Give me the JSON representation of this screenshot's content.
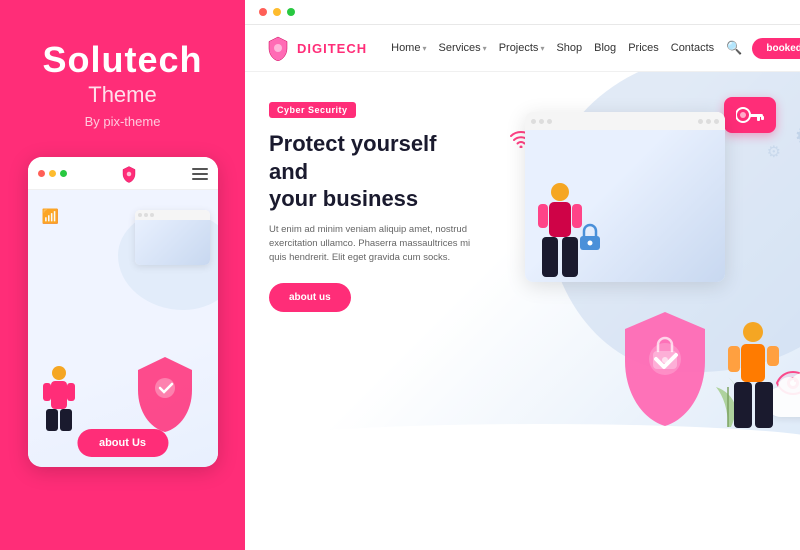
{
  "left": {
    "brand_name": "Solutech",
    "brand_theme": "Theme",
    "brand_by": "By pix-theme",
    "mobile_about_btn": "about Us"
  },
  "browser": {
    "dots": [
      "red",
      "yellow",
      "green"
    ],
    "navbar": {
      "logo_text_prefix": "DIGI",
      "logo_text_suffix": "TECH",
      "links": [
        {
          "label": "Home",
          "has_chevron": true
        },
        {
          "label": "Services",
          "has_chevron": true
        },
        {
          "label": "Projects",
          "has_chevron": true
        },
        {
          "label": "Shop",
          "has_chevron": false
        },
        {
          "label": "Blog",
          "has_chevron": false
        },
        {
          "label": "Prices",
          "has_chevron": false
        },
        {
          "label": "Contacts",
          "has_chevron": false
        }
      ],
      "booked_btn": "booked"
    },
    "hero": {
      "badge": "Cyber Security",
      "title_line1": "Protect yourself and",
      "title_line2": "your business",
      "description": "Ut enim ad minim veniam aliquip amet, nostrud exercitation ullamco. Phaserra massaultrices mi quis hendrerit. Elit eget gravida cum socks.",
      "about_btn": "about us"
    }
  }
}
